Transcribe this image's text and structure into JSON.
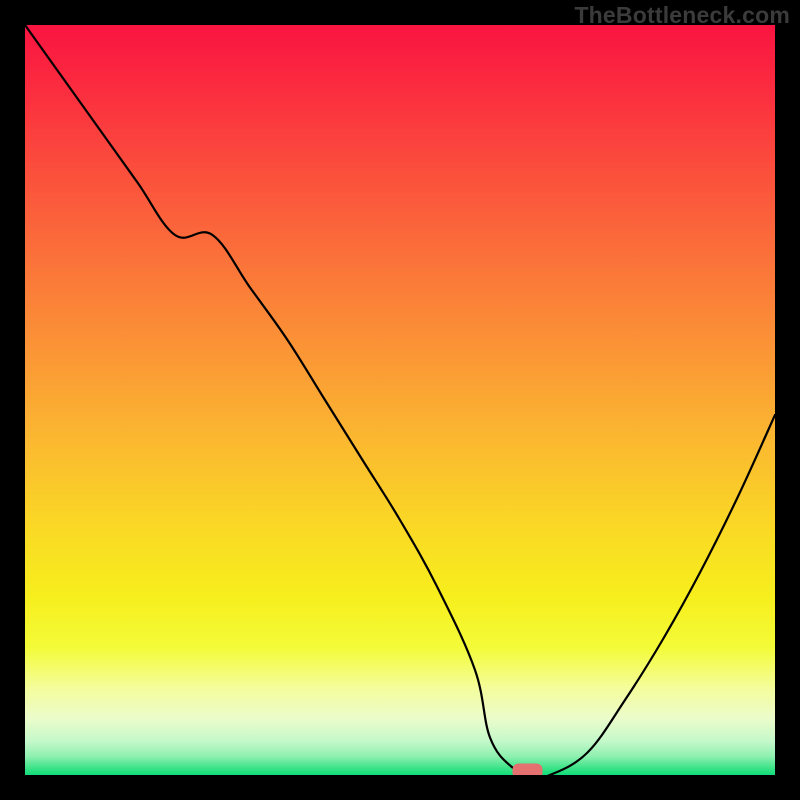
{
  "watermark": "TheBottleneck.com",
  "chart_data": {
    "type": "line",
    "title": "",
    "xlabel": "",
    "ylabel": "",
    "xlim": [
      0,
      100
    ],
    "ylim": [
      0,
      100
    ],
    "grid": false,
    "series": [
      {
        "name": "bottleneck-curve",
        "x": [
          0,
          5,
          10,
          15,
          20,
          25,
          30,
          35,
          40,
          45,
          50,
          55,
          60,
          62,
          65,
          68,
          70,
          75,
          80,
          85,
          90,
          95,
          100
        ],
        "y": [
          100,
          93,
          86,
          79,
          72,
          72,
          65,
          58,
          50,
          42,
          34,
          25,
          14,
          5,
          1,
          0,
          0,
          3,
          10,
          18,
          27,
          37,
          48
        ]
      }
    ],
    "marker": {
      "x": 67,
      "y": 0,
      "width": 4,
      "height": 2,
      "color": "#e4716f"
    },
    "gradient_stops": [
      {
        "offset": 0.0,
        "color": "#fa1440"
      },
      {
        "offset": 0.08,
        "color": "#fb2b3f"
      },
      {
        "offset": 0.18,
        "color": "#fb4a3d"
      },
      {
        "offset": 0.3,
        "color": "#fb6e3a"
      },
      {
        "offset": 0.42,
        "color": "#fb9136"
      },
      {
        "offset": 0.54,
        "color": "#fbb431"
      },
      {
        "offset": 0.66,
        "color": "#fad626"
      },
      {
        "offset": 0.76,
        "color": "#f7ee1c"
      },
      {
        "offset": 0.83,
        "color": "#f3fb38"
      },
      {
        "offset": 0.885,
        "color": "#f4fd9d"
      },
      {
        "offset": 0.925,
        "color": "#ebfccb"
      },
      {
        "offset": 0.955,
        "color": "#c4f8ca"
      },
      {
        "offset": 0.975,
        "color": "#8ff0b0"
      },
      {
        "offset": 0.99,
        "color": "#3fe48a"
      },
      {
        "offset": 1.0,
        "color": "#0fdd77"
      }
    ]
  }
}
